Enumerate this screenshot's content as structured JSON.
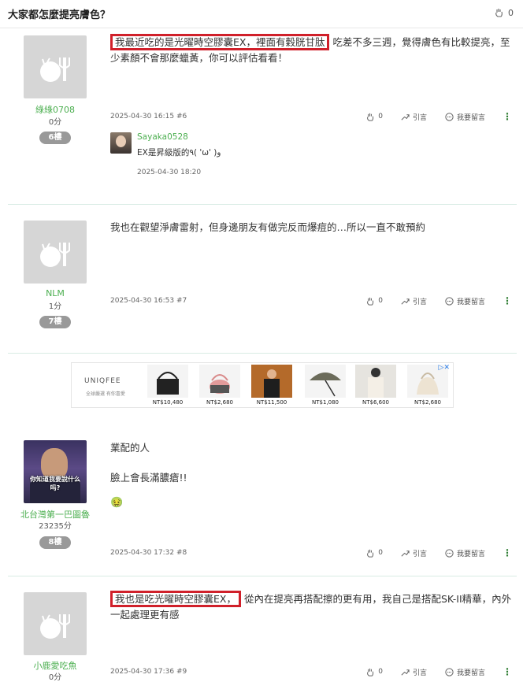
{
  "header": {
    "title": "大家都怎麼提亮膚色？",
    "likes": "0"
  },
  "posts": [
    {
      "username": "綠綠0708",
      "score": "0分",
      "floor": "6樓",
      "highlight": "我最近吃的是光曜時空膠囊EX，裡面有穀胱甘肽",
      "content_rest": "吃差不多三週，覺得膚色有比較提亮，至少素顏不會那麼蠟黃，你可以評估看看！",
      "meta": "2025-04-30 16:15 #6",
      "likes": "0",
      "quote": "引言",
      "comment": "我要留言",
      "reply": {
        "username": "Sayaka0528",
        "text": "EX是昇級版的٩( 'ω' )و",
        "time": "2025-04-30 18:20"
      }
    },
    {
      "username": "NLM",
      "score": "1分",
      "floor": "7樓",
      "content": "我也在觀望淨膚雷射，但身邊朋友有做完反而爆痘的…所以一直不敢預約",
      "meta": "2025-04-30 16:53 #7",
      "likes": "0",
      "quote": "引言",
      "comment": "我要留言"
    },
    {
      "username": "北台灣第一巴圖魯",
      "score": "23235分",
      "floor": "8樓",
      "avatar_caption": "你知道我要說什么吗?",
      "line1": "業配的人",
      "line2": "臉上會長滿膿瘡!!",
      "emoji": "🤢",
      "meta": "2025-04-30 17:32 #8",
      "likes": "0",
      "quote": "引言",
      "comment": "我要留言"
    },
    {
      "username": "小鹿愛吃魚",
      "score": "0分",
      "highlight": "我也是吃光曜時空膠囊EX，",
      "content_rest": "從內在提亮再搭配擦的更有用，我自己是搭配SK-II精華，內外一起處理更有感",
      "meta": "2025-04-30 17:36 #9",
      "likes": "0",
      "quote": "引言",
      "comment": "我要留言"
    }
  ],
  "ad": {
    "brand": "UNIQFEE",
    "brand_sub": "全球嚴選  有你喜愛",
    "prices": [
      "NT$10,480",
      "NT$2,680",
      "NT$11,500",
      "NT$1,080",
      "NT$6,600",
      "NT$2,680"
    ]
  }
}
